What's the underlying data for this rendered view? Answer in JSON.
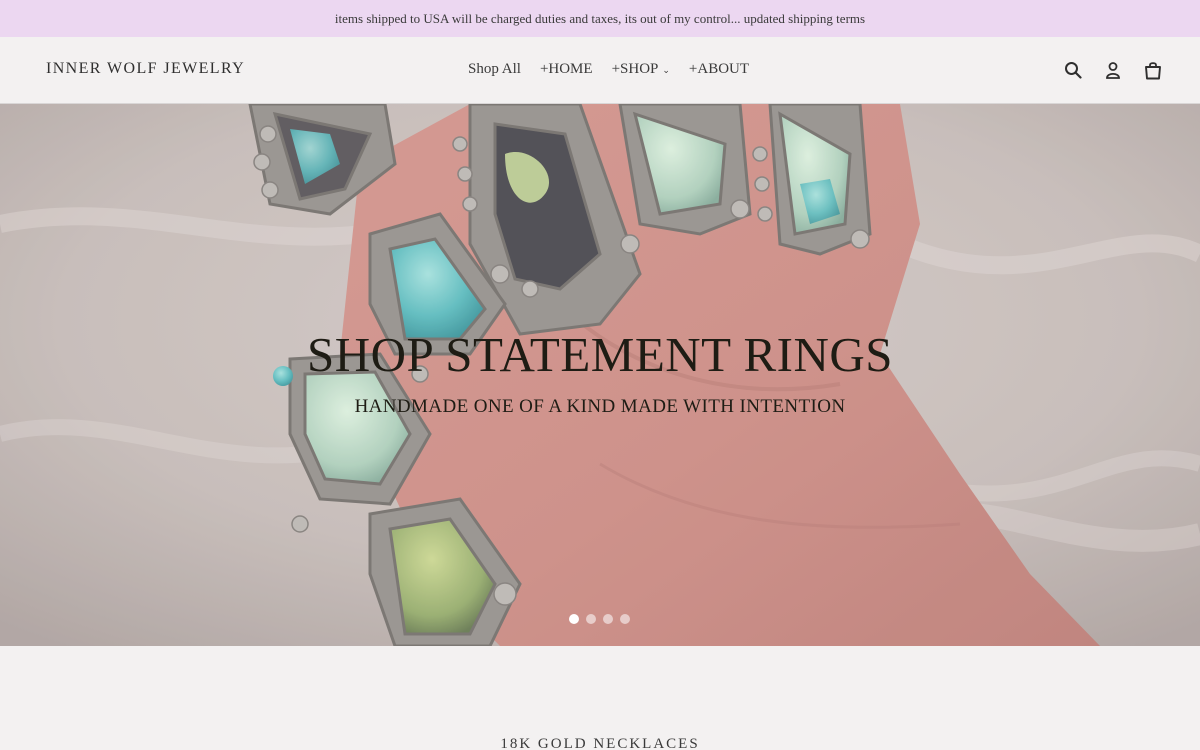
{
  "announcement": {
    "text": "items shipped to USA will be charged duties and taxes, its out of my control... updated shipping terms"
  },
  "header": {
    "logo": "INNER WOLF JEWELRY",
    "nav": [
      {
        "label": "Shop All"
      },
      {
        "label": "+HOME"
      },
      {
        "label": "+SHOP",
        "has_dropdown": true
      },
      {
        "label": "+ABOUT"
      }
    ],
    "icons": [
      "search-icon",
      "account-icon",
      "cart-icon"
    ]
  },
  "hero": {
    "title": "SHOP STATEMENT RINGS",
    "subtitle": "HANDMADE ONE OF A KIND MADE WITH INTENTION",
    "slide_count": 4,
    "active_slide": 1
  },
  "next_section": {
    "title": "18K GOLD NECKLACES"
  },
  "colors": {
    "announcement_bg": "#ecd7f1",
    "header_bg": "#f3f1f1",
    "hero_text": "#1e1c14",
    "turquoise": "#3fb3bd",
    "silver": "#8f8b87"
  }
}
